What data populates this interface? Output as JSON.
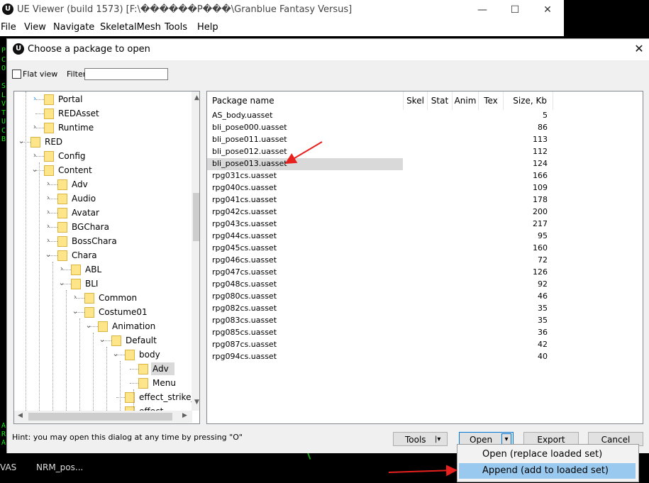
{
  "app": {
    "title": "UE Viewer (build 1573) [F:\\������Ρ���\\Granblue Fantasy Versus]",
    "icon": "ue-logo-icon",
    "window_controls": [
      "—",
      "☐",
      "✕"
    ],
    "menu": [
      "File",
      "View",
      "Navigate",
      "SkeletalMesh",
      "Tools",
      "Help"
    ]
  },
  "console": {
    "left_letters": [
      "P",
      "C",
      "O",
      "",
      "S",
      "L",
      "V",
      "T",
      "U",
      "C",
      "B"
    ],
    "bottom_left_letters": [
      "A",
      "R",
      "A"
    ],
    "bottom_items": [
      "VAS",
      "NRM_pos..."
    ]
  },
  "dialog": {
    "title": "Choose a package to open",
    "flat_view_label": "Flat view",
    "flat_view_checked": false,
    "filter_label": "Filter:",
    "filter_value": "",
    "tree": [
      {
        "label": "Portal",
        "depth": 1,
        "expander": "collapsed",
        "hot": true
      },
      {
        "label": "REDAsset",
        "depth": 1,
        "expander": "none"
      },
      {
        "label": "Runtime",
        "depth": 1,
        "expander": "collapsed"
      },
      {
        "label": "RED",
        "depth": 0,
        "expander": "expanded"
      },
      {
        "label": "Config",
        "depth": 1,
        "expander": "collapsed"
      },
      {
        "label": "Content",
        "depth": 1,
        "expander": "expanded"
      },
      {
        "label": "Adv",
        "depth": 2,
        "expander": "collapsed"
      },
      {
        "label": "Audio",
        "depth": 2,
        "expander": "collapsed"
      },
      {
        "label": "Avatar",
        "depth": 2,
        "expander": "collapsed"
      },
      {
        "label": "BGChara",
        "depth": 2,
        "expander": "collapsed"
      },
      {
        "label": "BossChara",
        "depth": 2,
        "expander": "collapsed"
      },
      {
        "label": "Chara",
        "depth": 2,
        "expander": "expanded"
      },
      {
        "label": "ABL",
        "depth": 3,
        "expander": "collapsed"
      },
      {
        "label": "BLI",
        "depth": 3,
        "expander": "expanded"
      },
      {
        "label": "Common",
        "depth": 4,
        "expander": "collapsed"
      },
      {
        "label": "Costume01",
        "depth": 4,
        "expander": "expanded"
      },
      {
        "label": "Animation",
        "depth": 5,
        "expander": "expanded"
      },
      {
        "label": "Default",
        "depth": 6,
        "expander": "expanded"
      },
      {
        "label": "body",
        "depth": 7,
        "expander": "expanded"
      },
      {
        "label": "Adv",
        "depth": 8,
        "expander": "none",
        "selected": true
      },
      {
        "label": "Menu",
        "depth": 8,
        "expander": "none"
      },
      {
        "label": "effect_strike_r",
        "depth": 7,
        "expander": "none"
      },
      {
        "label": "effect_...",
        "depth": 7,
        "expander": "none"
      }
    ],
    "list_headers": {
      "name": "Package name",
      "skel": "Skel",
      "stat": "Stat",
      "anim": "Anim",
      "tex": "Tex",
      "size": "Size, Kb"
    },
    "files": [
      {
        "name": "AS_body.uasset",
        "size": "5"
      },
      {
        "name": "bli_pose000.uasset",
        "size": "86"
      },
      {
        "name": "bli_pose011.uasset",
        "size": "113"
      },
      {
        "name": "bli_pose012.uasset",
        "size": "112"
      },
      {
        "name": "bli_pose013.uasset",
        "size": "124",
        "selected": true
      },
      {
        "name": "rpg031cs.uasset",
        "size": "166"
      },
      {
        "name": "rpg040cs.uasset",
        "size": "109"
      },
      {
        "name": "rpg041cs.uasset",
        "size": "178"
      },
      {
        "name": "rpg042cs.uasset",
        "size": "200"
      },
      {
        "name": "rpg043cs.uasset",
        "size": "217"
      },
      {
        "name": "rpg044cs.uasset",
        "size": "95"
      },
      {
        "name": "rpg045cs.uasset",
        "size": "160"
      },
      {
        "name": "rpg046cs.uasset",
        "size": "72"
      },
      {
        "name": "rpg047cs.uasset",
        "size": "126"
      },
      {
        "name": "rpg048cs.uasset",
        "size": "92"
      },
      {
        "name": "rpg080cs.uasset",
        "size": "46"
      },
      {
        "name": "rpg082cs.uasset",
        "size": "35"
      },
      {
        "name": "rpg083cs.uasset",
        "size": "35"
      },
      {
        "name": "rpg085cs.uasset",
        "size": "36"
      },
      {
        "name": "rpg087cs.uasset",
        "size": "42"
      },
      {
        "name": "rpg094cs.uasset",
        "size": "40"
      }
    ],
    "hint": "Hint: you may open this dialog at any time by pressing \"O\"",
    "buttons": {
      "tools": "Tools",
      "open": "Open",
      "export": "Export",
      "cancel": "Cancel"
    },
    "open_menu": [
      "Open (replace loaded set)",
      "Append (add to loaded set)"
    ],
    "open_menu_hot_index": 1
  },
  "colors": {
    "selection": "#d9d9d9",
    "menu_hot": "#99c9ef",
    "annotation_arrow": "#e8211f",
    "console_text": "#19e619",
    "folder": "#ffe58a"
  }
}
